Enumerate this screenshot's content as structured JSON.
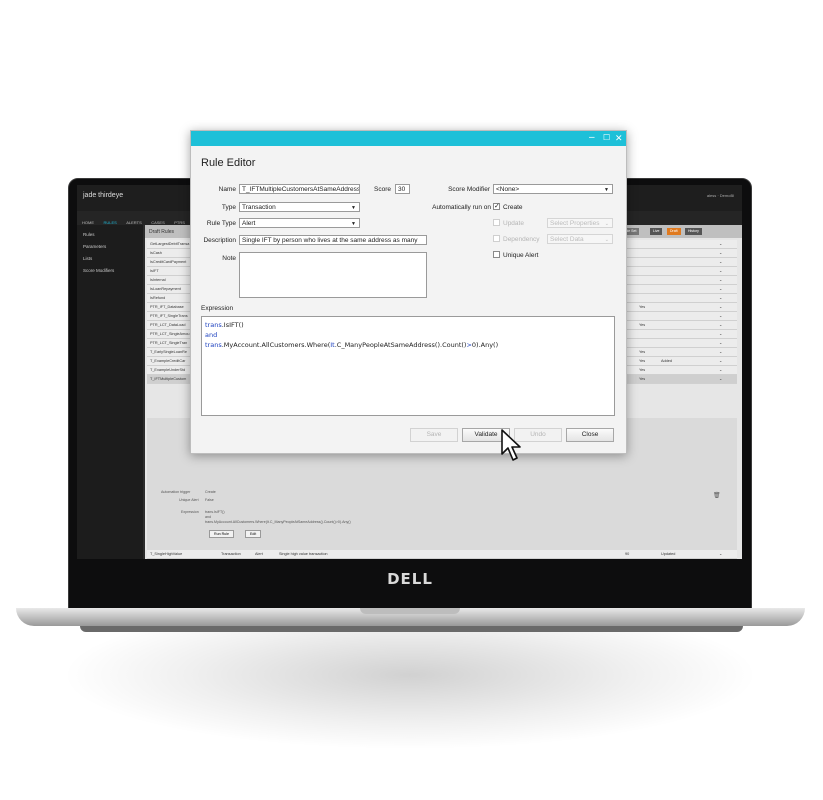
{
  "laptop": {
    "brand": "DELL"
  },
  "app": {
    "logo": "jade thirdeye",
    "user": "aless · DemoBl",
    "nav": [
      "HOME",
      "RULES",
      "ALERTS",
      "CASES",
      "PTRS",
      "WOR"
    ],
    "nav_active": 1,
    "sidebar": [
      "Rules",
      "Parameters",
      "Lists",
      "Score Modifiers"
    ],
    "list_title": "Draft Rules",
    "controls": {
      "rule_set": "Rule Set",
      "live": "Live",
      "draft": "Draft",
      "history": "History"
    },
    "rows": [
      {
        "name": "GetLargestDebitTransa",
        "score": "0",
        "flag": "",
        "status": ""
      },
      {
        "name": "IsCash",
        "score": "0",
        "flag": "",
        "status": ""
      },
      {
        "name": "IsCreditCardPayment",
        "score": "0",
        "flag": "",
        "status": ""
      },
      {
        "name": "IsIFT",
        "score": "0",
        "flag": "",
        "status": ""
      },
      {
        "name": "IsInternal",
        "score": "0",
        "flag": "",
        "status": ""
      },
      {
        "name": "IsLoanRepayment",
        "score": "0",
        "flag": "",
        "status": ""
      },
      {
        "name": "IsRefund",
        "score": "0",
        "flag": "",
        "status": ""
      },
      {
        "name": "PTR_IFT_Database",
        "score": "10",
        "flag": "Yes",
        "status": ""
      },
      {
        "name": "PTR_IFT_SingleTrans",
        "score": "1",
        "flag": "",
        "status": ""
      },
      {
        "name": "PTR_LCT_DataLoad",
        "score": "10",
        "flag": "Yes",
        "status": ""
      },
      {
        "name": "PTR_LCT_SingleAmou",
        "score": "1",
        "flag": "",
        "status": ""
      },
      {
        "name": "PTR_LCT_SingleTran",
        "score": "1",
        "flag": "",
        "status": ""
      },
      {
        "name": "T_EarlySingleLoanRe",
        "score": "70",
        "flag": "Yes",
        "status": ""
      },
      {
        "name": "T_ExampleCreditCar",
        "score": "50",
        "flag": "Yes",
        "status": "Added"
      },
      {
        "name": "T_ExampleUnderStd",
        "score": "50",
        "flag": "Yes",
        "status": ""
      },
      {
        "name": "T_IFTMultipleCustom",
        "score": "30",
        "flag": "Yes",
        "status": ""
      }
    ],
    "detail": {
      "automation_label": "Automation trigger",
      "automation_value": "Create",
      "unique_label": "Unique Alert",
      "unique_value": "False",
      "expression_label": "Expression",
      "expression_line1": "trans.IsIFT()",
      "expression_line2": "and",
      "expression_line3": "trans.MyAccount.AllCustomers.Where(It.C_ManyPeopleAtSameAddress().Count()>0).Any()",
      "run_rule": "Run Rule",
      "edit": "Edit"
    },
    "bottom_rows": [
      {
        "name": "T_SingleHighValue",
        "type": "Transaction",
        "rtype": "Alert",
        "desc": "Single high value transaction",
        "score": "90",
        "flag": "",
        "status": "Updated"
      },
      {
        "name": "T_SingleHighValueCashCredit",
        "type": "Transaction",
        "rtype": "Alert",
        "desc": "Single high value cash credit",
        "score": "80",
        "flag": "Yes",
        "status": "Updated"
      },
      {
        "name": "T_SingleIFTTaxHaven",
        "type": "Transaction",
        "rtype": "Alert",
        "desc": "Single transaction IFT to/from a tax haven",
        "score": "20",
        "flag": "Yes",
        "status": ""
      },
      {
        "name": "T_SingleIFTToHighRiskCountry",
        "type": "Transaction",
        "rtype": "Alert",
        "desc": "Single transaction IFT of any amount to a high risk country",
        "score": "100",
        "flag": "Yes",
        "status": ""
      },
      {
        "name": "T_SingleSIP",
        "type": "Transaction",
        "rtype": "Alert",
        "desc": "Alert on every transaction for a SIP",
        "score": "100",
        "flag": "Yes",
        "status": ""
      }
    ]
  },
  "dialog": {
    "title": "Rule Editor",
    "name_label": "Name",
    "name_value": "T_IFTMultipleCustomersAtSameAddress",
    "score_label": "Score",
    "score_value": "30",
    "score_modifier_label": "Score Modifier",
    "score_modifier_value": "<None>",
    "type_label": "Type",
    "type_value": "Transaction",
    "rule_type_label": "Rule Type",
    "rule_type_value": "Alert",
    "description_label": "Description",
    "description_value": "Single IFT by person who lives at the same address as many",
    "note_label": "Note",
    "auto_run_label": "Automatically run on",
    "create_label": "Create",
    "create_checked": true,
    "update_label": "Update",
    "update_placeholder": "Select Properties",
    "dependency_label": "Dependency",
    "dependency_placeholder": "Select Data",
    "unique_alert_label": "Unique Alert",
    "expression_label": "Expression",
    "expression": {
      "line1_a": "trans",
      "line1_b": ".IsIFT()",
      "line2": "and",
      "line3_a": "trans",
      "line3_b": ".MyAccount.AllCustomers.Where(",
      "line3_c": "It",
      "line3_d": ".C_ManyPeopleAtSameAddress().Count()",
      "line3_e": ">",
      "line3_f": "0).Any()"
    },
    "buttons": {
      "save": "Save",
      "validate": "Validate",
      "undo": "Undo",
      "close": "Close"
    }
  }
}
